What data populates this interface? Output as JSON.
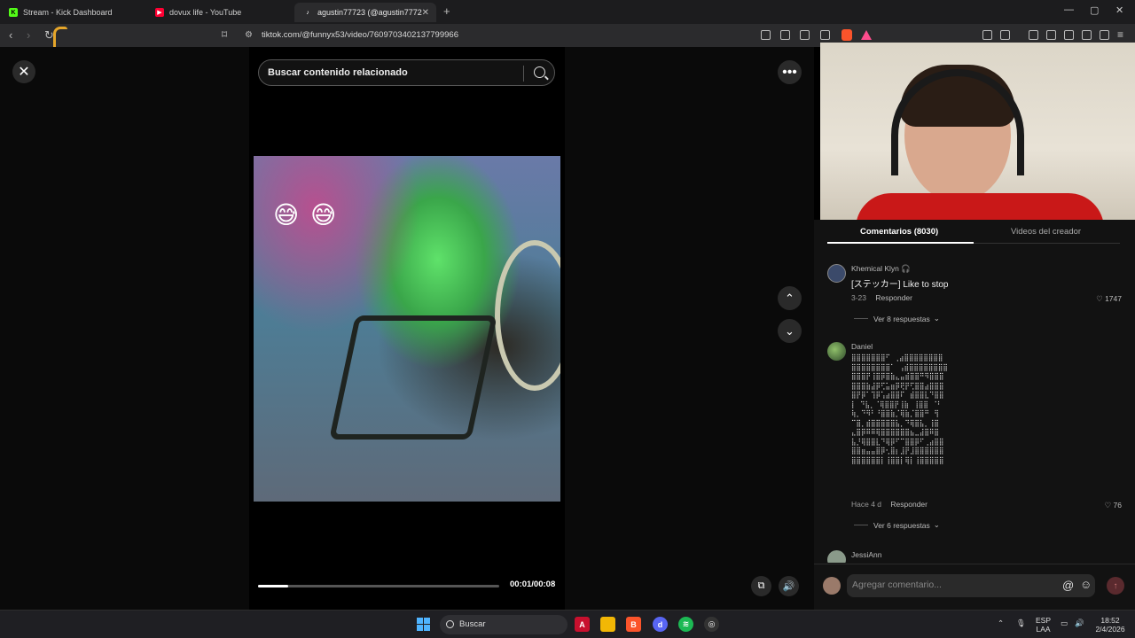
{
  "tabs": [
    {
      "title": "Stream - Kick Dashboard",
      "fav_color": "#53fc18",
      "fav_glyph": "K"
    },
    {
      "title": "dovux life - YouTube",
      "fav_color": "#ff0033",
      "fav_glyph": "▶"
    },
    {
      "title": "agustin77723 (@agustin7772",
      "fav_color": "#ffffff",
      "fav_glyph": "♪"
    }
  ],
  "address": {
    "url": "tiktok.com/@funnyx53/video/7609703402137799966"
  },
  "search": {
    "placeholder": "Buscar contenido relacionado"
  },
  "player": {
    "emoji": [
      "😅",
      "😅"
    ],
    "progress": 0.125,
    "time": "00:01/00:08"
  },
  "comments_panel": {
    "tab_comments": "Comentarios (8030)",
    "tab_creator": "Videos del creador",
    "comments": [
      {
        "user": "Khemical Klyn 🎧",
        "text": "[ステッカー] Like to stop",
        "date": "3-23",
        "reply": "Responder",
        "likes": "1747",
        "view_replies": "Ver 8 respuestas"
      },
      {
        "user": "Daniel",
        "ascii": "⣿⣿⣿⣿⣿⣿⣿⠋ ⢀⣴⣿⣿⣿⣿⣿⣿⣿⣿\n⣿⣿⣿⣿⣿⣿⣿⣿⠁ ⢠⣾⣿⣿⣿⣿⣿⣿⣿⣿\n⣿⣿⣿⡟⢸⣿⡿⣿⣷⣄⣤⣾⣿⣿⠛⠻⣿⣿⣿\n⣿⣿⣿⣷⣼⡿⢋⣥⣶⡿⢟⡟⢋⣿⣿⣴⣿⣿⣿\n⣿⡟⡿⠁⢹⡿⢡⣴⣿⣿⠏⠀⣾⣿⣿⣇⠙⣿⣿\n⡇ ⠙⣧⡀⠈⢿⣿⣿⡟⢸⣷⠀⢸⣿⣿ ⠈⠃\n⢷⡀⠙⠻⠃⠘⣿⣿⣷⡈⢿⣷⡈⣿⣿⠛⠀⢻\n⠉⣿⡀⣾⣿⣿⣿⣿⣿⣧⡀⠙⢿⣿⣧⡀⢸⣿\n⣄⣿⡿⠿⠿⢿⣿⣿⣿⣿⣿⣿⣦⣀⣼⣿⠿⣿\n⣧⡘⢿⣿⣿⣇⠙⢿⡿⠋⠉⣿⣿⡿⠋⢀⣴⣿⣿\n⣿⣿⣶⣤⣤⣿⡿⢂⣿⡆⣸⡟⣸⣿⣿⣿⣿⣿⣿\n⣿⣿⣿⣿⣿⣿⡇⢸⣿⣿⡇⢿⡇⢸⣿⣿⣿⣿⣿",
        "date": "Hace 4 d",
        "reply": "Responder",
        "likes": "76",
        "view_replies": "Ver 6 respuestas"
      },
      {
        "user": "JessiAnn"
      }
    ],
    "add_placeholder": "Agregar comentario..."
  },
  "taskbar": {
    "search_label": "Buscar",
    "lang_top": "ESP",
    "lang_bottom": "LAA",
    "time": "18:52",
    "date": "2/4/2026"
  }
}
